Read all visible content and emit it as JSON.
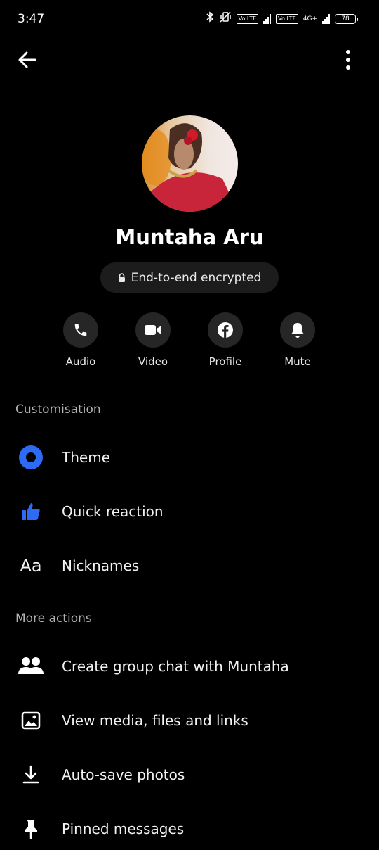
{
  "status_bar": {
    "time": "3:47",
    "network_label": "4G+",
    "volte_label": "Vo LTE",
    "battery": "78"
  },
  "header": {
    "back_icon": "arrow-left-icon",
    "menu_icon": "more-vertical-icon"
  },
  "profile": {
    "name": "Muntaha Aru",
    "encryption_label": "End-to-end encrypted"
  },
  "quick_actions": [
    {
      "label": "Audio",
      "icon": "phone-icon"
    },
    {
      "label": "Video",
      "icon": "video-camera-icon"
    },
    {
      "label": "Profile",
      "icon": "facebook-icon"
    },
    {
      "label": "Mute",
      "icon": "bell-icon"
    }
  ],
  "customisation": {
    "title": "Customisation",
    "items": [
      {
        "label": "Theme",
        "icon": "theme-icon"
      },
      {
        "label": "Quick reaction",
        "icon": "thumbs-up-icon"
      },
      {
        "label": "Nicknames",
        "icon": "font-aa-icon",
        "icon_text": "Aa"
      }
    ]
  },
  "more_actions": {
    "title": "More actions",
    "items": [
      {
        "label": "Create group chat with Muntaha",
        "icon": "people-icon"
      },
      {
        "label": "View media, files and links",
        "icon": "image-icon"
      },
      {
        "label": "Auto-save photos",
        "icon": "download-icon"
      },
      {
        "label": "Pinned messages",
        "icon": "pin-icon"
      }
    ]
  },
  "colors": {
    "background": "#000000",
    "accent_blue": "#2d6bf5",
    "button_bg": "#262626",
    "pill_bg": "#1c1c1c"
  }
}
